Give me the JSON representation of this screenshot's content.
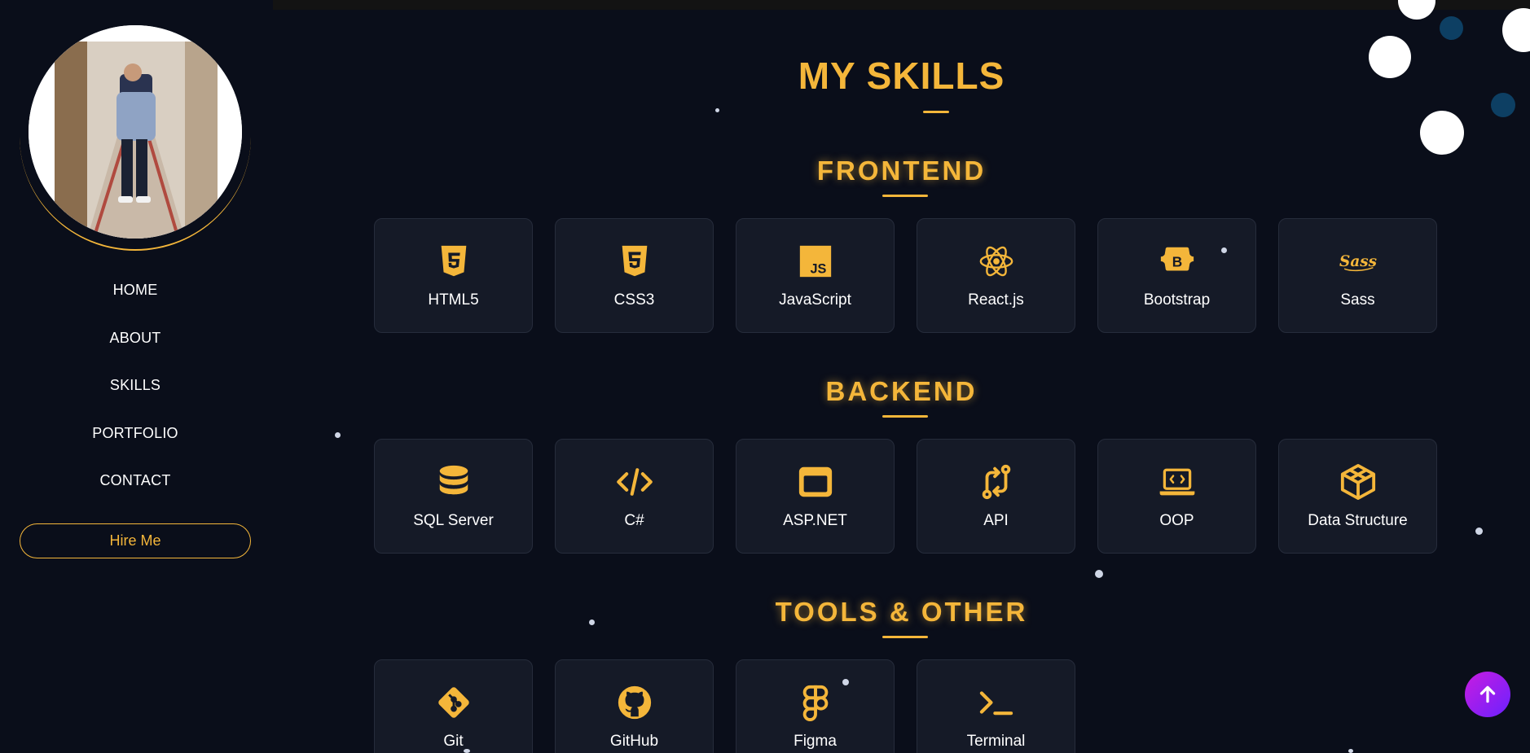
{
  "sidebar": {
    "nav": [
      "HOME",
      "ABOUT",
      "SKILLS",
      "PORTFOLIO",
      "CONTACT"
    ],
    "hire_label": "Hire Me"
  },
  "main": {
    "title": "MY SKILLS",
    "sections": [
      {
        "title": "FRONTEND",
        "items": [
          {
            "label": "HTML5",
            "icon": "html5-icon"
          },
          {
            "label": "CSS3",
            "icon": "css3-icon"
          },
          {
            "label": "JavaScript",
            "icon": "javascript-icon"
          },
          {
            "label": "React.js",
            "icon": "react-icon"
          },
          {
            "label": "Bootstrap",
            "icon": "bootstrap-icon"
          },
          {
            "label": "Sass",
            "icon": "sass-icon"
          }
        ]
      },
      {
        "title": "BACKEND",
        "items": [
          {
            "label": "SQL Server",
            "icon": "database-icon"
          },
          {
            "label": "C#",
            "icon": "code-icon"
          },
          {
            "label": "ASP.NET",
            "icon": "window-icon"
          },
          {
            "label": "API",
            "icon": "api-icon"
          },
          {
            "label": "OOP",
            "icon": "laptop-code-icon"
          },
          {
            "label": "Data Structure",
            "icon": "cube-icon"
          }
        ]
      },
      {
        "title": "TOOLS & OTHER",
        "items": [
          {
            "label": "Git",
            "icon": "git-icon"
          },
          {
            "label": "GitHub",
            "icon": "github-icon"
          },
          {
            "label": "Figma",
            "icon": "figma-icon"
          },
          {
            "label": "Terminal",
            "icon": "terminal-icon"
          }
        ]
      }
    ]
  },
  "colors": {
    "accent": "#f4b63a",
    "background": "#0a0e1a",
    "card": "#151a27",
    "scroll_button": "#b01ee8"
  }
}
